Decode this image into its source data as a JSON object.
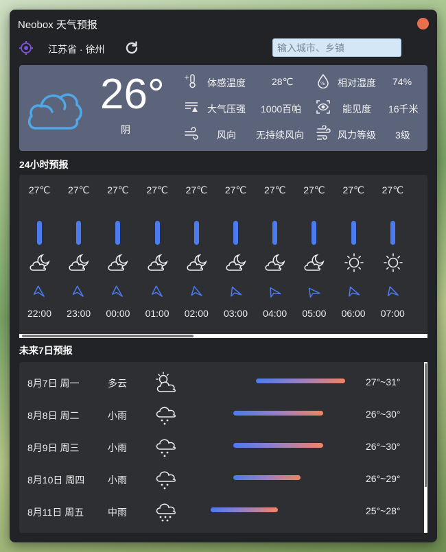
{
  "app": {
    "title": "Neobox 天气预报"
  },
  "location": {
    "name": "江苏省 · 徐州"
  },
  "search": {
    "placeholder": "输入城市、乡镇"
  },
  "current": {
    "temp": "26°",
    "condition": "阴",
    "metrics": [
      {
        "icon": "thermometer-icon",
        "label": "体感温度",
        "value": "28℃"
      },
      {
        "icon": "humidity-icon",
        "label": "相对湿度",
        "value": "74%"
      },
      {
        "icon": "pressure-icon",
        "label": "大气压强",
        "value": "1000百帕"
      },
      {
        "icon": "visibility-icon",
        "label": "能见度",
        "value": "16千米"
      },
      {
        "icon": "wind-direction-icon",
        "label": "风向",
        "value": "无持续风向"
      },
      {
        "icon": "wind-level-icon",
        "label": "风力等级",
        "value": "3级"
      }
    ]
  },
  "hourly": {
    "title": "24小时预报",
    "items": [
      {
        "temp": "27℃",
        "icon": "moon-cloud-icon",
        "time": "22:00",
        "wind_icon": "wind-arrow-icon"
      },
      {
        "temp": "27℃",
        "icon": "moon-cloud-icon",
        "time": "23:00",
        "wind_icon": "wind-arrow-icon"
      },
      {
        "temp": "27℃",
        "icon": "moon-cloud-icon",
        "time": "00:00",
        "wind_icon": "wind-arrow-icon"
      },
      {
        "temp": "27℃",
        "icon": "moon-cloud-icon",
        "time": "01:00",
        "wind_icon": "wind-arrow-icon"
      },
      {
        "temp": "27℃",
        "icon": "moon-cloud-icon",
        "time": "02:00",
        "wind_icon": "wind-arrow-icon"
      },
      {
        "temp": "27℃",
        "icon": "moon-cloud-icon",
        "time": "03:00",
        "wind_icon": "wind-arrow-icon"
      },
      {
        "temp": "27℃",
        "icon": "moon-cloud-icon",
        "time": "04:00",
        "wind_icon": "wind-arrow-icon"
      },
      {
        "temp": "27℃",
        "icon": "moon-cloud-icon",
        "time": "05:00",
        "wind_icon": "wind-arrow-icon"
      },
      {
        "temp": "27℃",
        "icon": "sun-icon",
        "time": "06:00",
        "wind_icon": "wind-arrow-icon"
      },
      {
        "temp": "27℃",
        "icon": "sun-icon",
        "time": "07:00",
        "wind_icon": "wind-arrow-icon"
      }
    ]
  },
  "daily": {
    "title": "未来7日预报",
    "items": [
      {
        "date": "8月7日 周一",
        "condition": "多云",
        "icon": "partly-cloudy-icon",
        "range": "27°~31°",
        "low": 27,
        "high": 31
      },
      {
        "date": "8月8日 周二",
        "condition": "小雨",
        "icon": "light-rain-icon",
        "range": "26°~30°",
        "low": 26,
        "high": 30
      },
      {
        "date": "8月9日 周三",
        "condition": "小雨",
        "icon": "light-rain-icon",
        "range": "26°~30°",
        "low": 26,
        "high": 30
      },
      {
        "date": "8月10日 周四",
        "condition": "小雨",
        "icon": "light-rain-icon",
        "range": "26°~29°",
        "low": 26,
        "high": 29
      },
      {
        "date": "8月11日 周五",
        "condition": "中雨",
        "icon": "moderate-rain-icon",
        "range": "25°~28°",
        "low": 25,
        "high": 28
      }
    ]
  },
  "colors": {
    "window_bg": "#222326",
    "current_panel": "#5c647c",
    "card_bg": "#2e2f33",
    "accent_blue": "#4b7bef",
    "accent_orange": "#ef8462",
    "close": "#e8704f"
  }
}
